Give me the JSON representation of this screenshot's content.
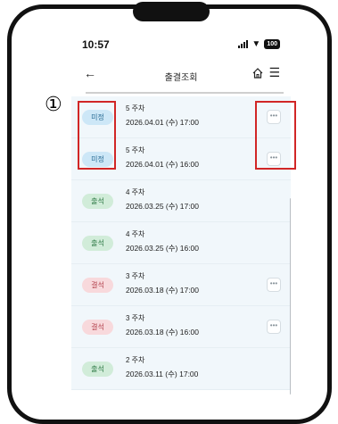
{
  "status_bar": {
    "time": "10:57",
    "battery": "100"
  },
  "nav": {
    "title": "출결조회"
  },
  "attendance_rows": [
    {
      "status": "미정",
      "status_type": "unset",
      "week": "5 주차",
      "datetime": "2026.04.01 (수) 17:00",
      "has_more": true
    },
    {
      "status": "미정",
      "status_type": "unset",
      "week": "5 주차",
      "datetime": "2026.04.01 (수) 16:00",
      "has_more": true
    },
    {
      "status": "출석",
      "status_type": "present",
      "week": "4 주차",
      "datetime": "2026.03.25 (수) 17:00",
      "has_more": false
    },
    {
      "status": "출석",
      "status_type": "present",
      "week": "4 주차",
      "datetime": "2026.03.25 (수) 16:00",
      "has_more": false
    },
    {
      "status": "결석",
      "status_type": "absent",
      "week": "3 주차",
      "datetime": "2026.03.18 (수) 17:00",
      "has_more": true
    },
    {
      "status": "결석",
      "status_type": "absent",
      "week": "3 주차",
      "datetime": "2026.03.18 (수) 16:00",
      "has_more": true
    },
    {
      "status": "출석",
      "status_type": "present",
      "week": "2 주차",
      "datetime": "2026.03.11 (수) 17:00",
      "has_more": false
    }
  ],
  "annotation": {
    "label": "①"
  },
  "colors": {
    "annotation_red": "#d12626",
    "unset_badge": "#cde7f7",
    "present_badge": "#d1ecd9",
    "absent_badge": "#f8d9dc",
    "row_background": "#f1f7fb"
  }
}
